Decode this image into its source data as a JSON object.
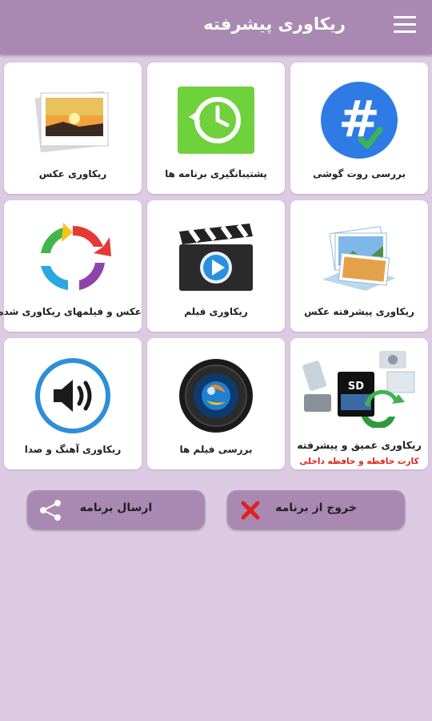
{
  "header": {
    "title": "ریکاوری پیشرفته",
    "menu_icon": "hamburger-menu-icon"
  },
  "cards": [
    {
      "label": "بررسی روت گوشی",
      "icon": "root-check-icon"
    },
    {
      "label": "پشتیبانگیری برنامه ها",
      "icon": "backup-clock-icon"
    },
    {
      "label": "ریکاوری عکس",
      "icon": "photo-icon"
    },
    {
      "label": "ریکاوری پیشرفته عکس",
      "icon": "photo-stack-icon"
    },
    {
      "label": "ریکاوری فیلم",
      "icon": "clapperboard-icon"
    },
    {
      "label": "عکس و فیلمهای ریکاوری شده",
      "icon": "recycle-arrows-icon"
    },
    {
      "label": "ریکاوری عمیق و پیشرفته",
      "sublabel": "کارت حافظه و حافظه داخلی",
      "icon": "devices-sdcard-icon"
    },
    {
      "label": "بررسی فیلم ها",
      "icon": "camera-lens-icon"
    },
    {
      "label": "ریکاوری آهنگ و صدا",
      "icon": "speaker-icon"
    }
  ],
  "buttons": {
    "exit_label": "خروج از برنامه",
    "share_label": "ارسال برنامه"
  },
  "colors": {
    "appbar": "#a989b2",
    "background": "#dccbe2",
    "card": "#ffffff",
    "accent_red": "#e0221c"
  }
}
